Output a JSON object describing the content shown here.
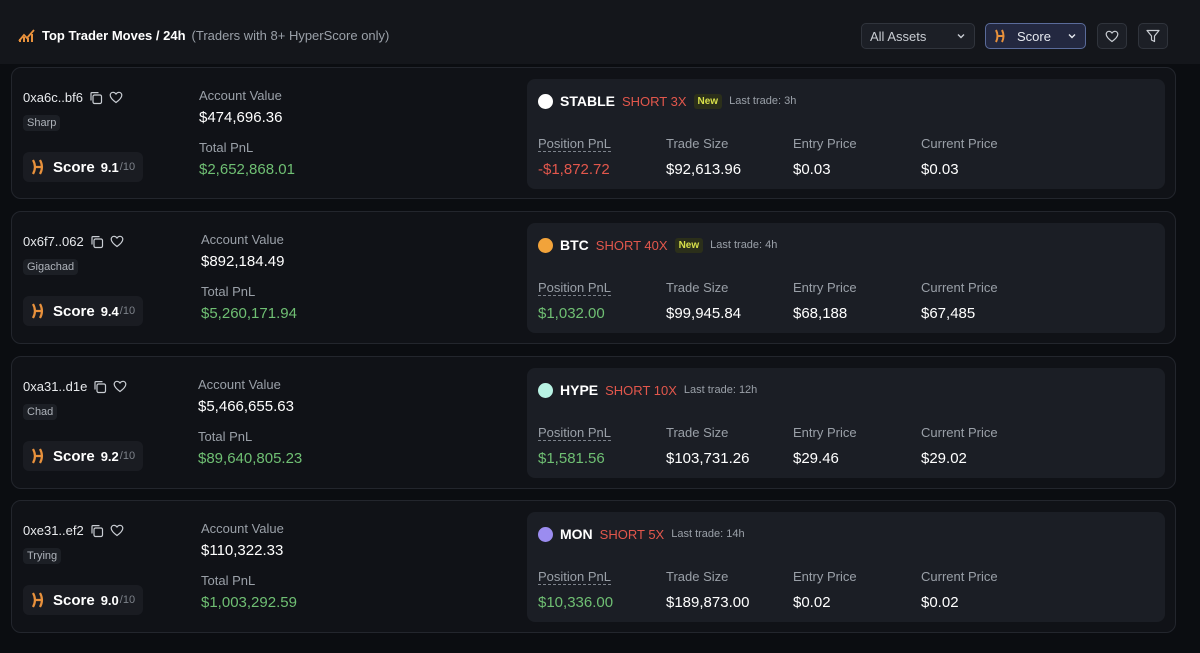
{
  "header": {
    "title": "Top Trader Moves / 24h",
    "subtitle": "(Traders with 8+ HyperScore only)",
    "assets_select": "All Assets",
    "sort_select": "Score",
    "icons": [
      "chart-icon",
      "chevron-down-icon",
      "hyperscore-logo-icon",
      "heart-icon",
      "filter-icon"
    ]
  },
  "labels": {
    "account_value": "Account Value",
    "total_pnl": "Total PnL",
    "score": "Score",
    "position_pnl": "Position PnL",
    "trade_size": "Trade Size",
    "entry_price": "Entry Price",
    "current_price": "Current Price"
  },
  "traders": [
    {
      "address": "0xa6c..bf6",
      "tag": "Sharp",
      "score": "9.1",
      "score_max": "/10",
      "account_value": "$474,696.36",
      "total_pnl": "$2,652,868.01",
      "position": {
        "asset": "STABLE",
        "side": "SHORT 3X",
        "badge": "New",
        "last_trade": "Last trade: 3h",
        "coin_color": "#ffffff",
        "pnl": "-$1,872.72",
        "pnl_sign": "negative",
        "trade_size": "$92,613.96",
        "entry_price": "$0.03",
        "current_price": "$0.03"
      }
    },
    {
      "address": "0x6f7..062",
      "tag": "Gigachad",
      "score": "9.4",
      "score_max": "/10",
      "account_value": "$892,184.49",
      "total_pnl": "$5,260,171.94",
      "position": {
        "asset": "BTC",
        "side": "SHORT 40X",
        "badge": "New",
        "last_trade": "Last trade: 4h",
        "coin_color": "#f2a33a",
        "pnl": "$1,032.00",
        "pnl_sign": "positive",
        "trade_size": "$99,945.84",
        "entry_price": "$68,188",
        "current_price": "$67,485"
      }
    },
    {
      "address": "0xa31..d1e",
      "tag": "Chad",
      "score": "9.2",
      "score_max": "/10",
      "account_value": "$5,466,655.63",
      "total_pnl": "$89,640,805.23",
      "position": {
        "asset": "HYPE",
        "side": "SHORT 10X",
        "badge": "",
        "last_trade": "Last trade: 12h",
        "coin_color": "#b9f3e4",
        "pnl": "$1,581.56",
        "pnl_sign": "positive",
        "trade_size": "$103,731.26",
        "entry_price": "$29.46",
        "current_price": "$29.02"
      }
    },
    {
      "address": "0xe31..ef2",
      "tag": "Trying",
      "score": "9.0",
      "score_max": "/10",
      "account_value": "$110,322.33",
      "total_pnl": "$1,003,292.59",
      "position": {
        "asset": "MON",
        "side": "SHORT 5X",
        "badge": "",
        "last_trade": "Last trade: 14h",
        "coin_color": "#9b8cf0",
        "pnl": "$10,336.00",
        "pnl_sign": "positive",
        "trade_size": "$189,873.00",
        "entry_price": "$0.02",
        "current_price": "$0.02"
      }
    }
  ]
}
